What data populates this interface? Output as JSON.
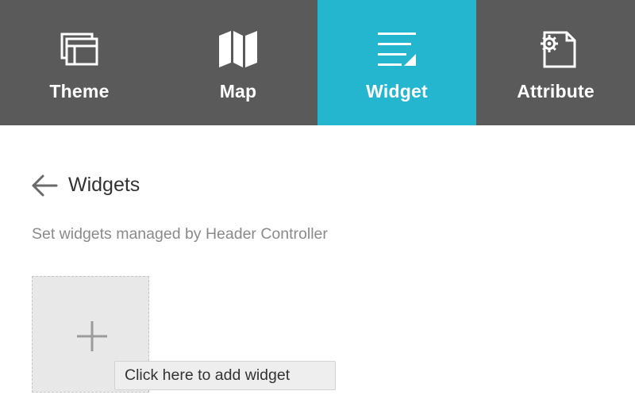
{
  "tabs": [
    {
      "label": "Theme",
      "icon": "theme-icon",
      "active": false
    },
    {
      "label": "Map",
      "icon": "map-icon",
      "active": false
    },
    {
      "label": "Widget",
      "icon": "widget-icon",
      "active": true
    },
    {
      "label": "Attribute",
      "icon": "attribute-gear-icon",
      "active": false
    }
  ],
  "colors": {
    "tabbar_bg": "#5a5a5a",
    "active_tab": "#24b5cf",
    "text_dark": "#333333",
    "text_muted": "#8a8a8a"
  },
  "panel": {
    "back_icon": "arrow-left-icon",
    "title": "Widgets",
    "description": "Set widgets managed by Header Controller",
    "add_icon": "plus-icon",
    "tooltip": "Click here to add widget"
  }
}
